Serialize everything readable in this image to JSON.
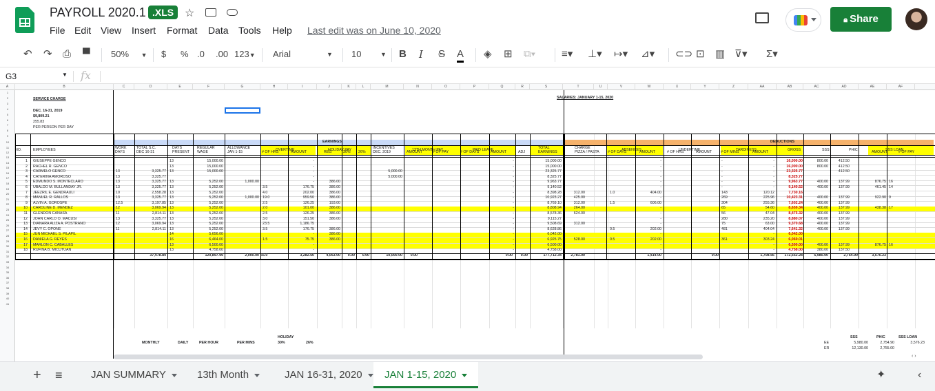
{
  "doc": {
    "title": "PAYROLL 2020.1",
    "badge": ".XLS",
    "last_edit": "Last edit was on June 10, 2020",
    "share": "Share"
  },
  "menu": [
    "File",
    "Edit",
    "View",
    "Insert",
    "Format",
    "Data",
    "Tools",
    "Help"
  ],
  "toolbar": {
    "zoom": "50%",
    "currency": "$",
    "percent": "%",
    "dec0": ".0",
    "dec00": ".00",
    "fmt": "123",
    "font": "Arial",
    "size": "10",
    "bold": "B",
    "italic": "I",
    "strike": "S",
    "textcolor": "A"
  },
  "formula": {
    "namebox": "G3",
    "fx": "fx"
  },
  "colors": {
    "earnings": "#c9daf8",
    "deductions": "#f6b26b",
    "yellow": "#ffff00",
    "green": "#188038",
    "red": "#cc0000"
  },
  "columns": [
    "A",
    "B",
    "C",
    "D",
    "E",
    "F",
    "G",
    "H",
    "I",
    "J",
    "K",
    "L",
    "M",
    "N",
    "O",
    "P",
    "Q",
    "R",
    "S",
    "T",
    "U",
    "V",
    "W",
    "X",
    "Y",
    "Z",
    "AA",
    "AB",
    "AC",
    "AD",
    "AE",
    "AF"
  ],
  "rownums": [
    "1",
    "2",
    "3",
    "4",
    "5",
    "6",
    "7",
    "8",
    "9",
    "10",
    "11",
    "12",
    "13",
    "14",
    "15",
    "16",
    "17",
    "18",
    "19",
    "20",
    "21",
    "22",
    "23",
    "24",
    "25",
    "26",
    "27",
    "28",
    "29",
    "30",
    "31",
    "32",
    "33",
    "34",
    "35",
    "36",
    "37",
    "38",
    "39",
    "40",
    "41"
  ],
  "sheet": {
    "service": {
      "label": "SERVICE CHARGE",
      "period": "DEC. 16-31, 2019",
      "amount": "$9,809.21",
      "rate": "255.83",
      "per": "PER PERSON PER DAY"
    },
    "salaries_title": "SALARIES: JANUARY 1-15, 2020",
    "earnings": "EARNINGS",
    "deductions": "DEDUCTIONS",
    "h1": {
      "no": "NO.",
      "emp": "EMPLOYEES",
      "work": "WORK",
      "total_sc": "TOTAL S.C.",
      "days": "DAYS",
      "regular": "REGULAR",
      "allow": "ALLOWANCE",
      "ot": "OVERTIME",
      "holiday": "HOLIDAY PAY",
      "incent": "INCENTIVES",
      "month13": "13TH MONTH PAY",
      "paid": "PAID LEAVE",
      "total": "TOTAL",
      "charge": "CHARGE",
      "absences": "ABSENCES",
      "undertime": "UNDERTIME",
      "tard": "TARDINESS",
      "gross": "GROSS",
      "sss": "SSS",
      "phic": "PHIC",
      "sssloan": "SSS LOAN"
    },
    "h2": {
      "work": "DAYS",
      "total_sc": "DEC 16-31",
      "days": "PRESENT",
      "regular": "WAGE",
      "allow": "JAN 1-15",
      "ot1": "# OF HRS",
      "ot2": "AMOUNT",
      "hol1": "REG",
      "hol2": "30%",
      "hol3": "26%",
      "incent": "DEC. 2019",
      "m1": "AMOUNT",
      "m2": "# OF PAY",
      "p1": "# OF DAYS",
      "p2": "AMOUNT",
      "adj": "ADJ",
      "total": "EARNINGS",
      "charge": "PIZZA / PASTA",
      "ab1": "# OF DAYS",
      "ab2": "AMOUNT",
      "u1": "# OF HRS",
      "u2": "AMOUNT",
      "t1": "# OF MINS",
      "t2": "AMOUNT",
      "sl1": "AMOUNT",
      "sl2": "# OF PAY"
    },
    "rows": [
      {
        "no": "1",
        "name": "GIUSEPPE GENCO",
        "c": "",
        "d": "",
        "e": "13",
        "f": "15,000.00",
        "g": "",
        "h": "",
        "i": "-",
        "j": "",
        "m": "",
        "p": "-",
        "s": "15,000.00",
        "u": "",
        "v": "",
        "w": "-",
        "y": "-",
        "aa": "-",
        "ab": "16,000.00",
        "ac": "800.00",
        "ad": "412.50",
        "ae": "",
        "af": "",
        "hl": false
      },
      {
        "no": "2",
        "name": "RACHEL R. GENCO",
        "c": "",
        "d": "",
        "e": "13",
        "f": "15,000.00",
        "g": "",
        "h": "",
        "i": "-",
        "j": "",
        "m": "",
        "p": "-",
        "s": "15,000.00",
        "u": "",
        "v": "",
        "w": "-",
        "y": "-",
        "aa": "-",
        "ab": "16,000.00",
        "ac": "800.00",
        "ad": "412.50",
        "ae": "",
        "af": "",
        "hl": false
      },
      {
        "no": "3",
        "name": "CARMELO GENCO",
        "c": "13",
        "d": "3,325.77",
        "e": "13",
        "f": "15,000.00",
        "g": "",
        "h": "",
        "i": "-",
        "j": "",
        "m": "5,000.00",
        "p": "-",
        "s": "23,325.77",
        "u": "",
        "v": "",
        "w": "-",
        "y": "-",
        "aa": "-",
        "ab": "23,325.77",
        "ac": "",
        "ad": "412.50",
        "ae": "",
        "af": "",
        "hl": false
      },
      {
        "no": "4",
        "name": "CATERINA AMOROSO",
        "c": "13",
        "d": "3,325.77",
        "e": "",
        "f": "",
        "g": "",
        "h": "",
        "i": "-",
        "j": "",
        "m": "5,000.00",
        "p": "-",
        "s": "8,325.77",
        "u": "",
        "v": "",
        "w": "-",
        "y": "-",
        "aa": "-",
        "ab": "8,325.77",
        "ac": "",
        "ad": "",
        "ae": "",
        "af": "",
        "hl": false
      },
      {
        "no": "5",
        "name": "EDMUNDO S. MONTECLARO",
        "c": "13",
        "d": "3,325.77",
        "e": "13",
        "f": "5,252.00",
        "g": "1,000.00",
        "h": "",
        "i": "-",
        "j": "386.00",
        "m": "",
        "p": "-",
        "s": "9,963.77",
        "u": "",
        "v": "",
        "w": "-",
        "y": "-",
        "aa": "-",
        "ab": "9,963.77",
        "ac": "400.00",
        "ad": "137.99",
        "ae": "876.75",
        "af": "16",
        "hl": false
      },
      {
        "no": "6",
        "name": "UBALDO M. BULLANDAY JR.",
        "c": "13",
        "d": "3,325.77",
        "e": "13",
        "f": "5,252.00",
        "g": "",
        "h": "3.5",
        "i": "176.75",
        "j": "386.00",
        "m": "",
        "p": "-",
        "s": "9,140.52",
        "u": "",
        "v": "",
        "w": "-",
        "y": "-",
        "aa": "-",
        "ab": "9,140.52",
        "ac": "400.00",
        "ad": "137.99",
        "ae": "461.45",
        "af": "14",
        "hl": false
      },
      {
        "no": "7",
        "name": "JEEZRIL E. GENDRAULI",
        "c": "10",
        "d": "2,558.28",
        "e": "13",
        "f": "5,252.00",
        "g": "",
        "h": "4.0",
        "i": "202.00",
        "j": "386.00",
        "m": "",
        "p": "-",
        "s": "8,398.28",
        "u": "312.00",
        "v": "1.0",
        "w": "404.00",
        "y": "143",
        "aa": "120.12",
        "ab": "7,730.16",
        "ac": "",
        "ad": "",
        "ae": "",
        "af": "",
        "hl": false
      },
      {
        "no": "8",
        "name": "MANUEL R. RALLOS",
        "c": "13",
        "d": "3,325.77",
        "e": "13",
        "f": "5,252.00",
        "g": "1,000.00",
        "h": "19.0",
        "i": "959.50",
        "j": "386.00",
        "m": "",
        "p": "-",
        "s": "10,923.27",
        "u": "425.00",
        "v": "",
        "w": "-",
        "y": "269",
        "aa": "225.96",
        "ab": "10,423.31",
        "ac": "400.00",
        "ad": "137.99",
        "ae": "922.90",
        "af": "9",
        "hl": false
      },
      {
        "no": "9",
        "name": "ALVIN A. GOROSPE",
        "c": "12.5",
        "d": "3,197.85",
        "e": "13",
        "f": "5,252.00",
        "g": "",
        "h": "2.5",
        "i": "126.25",
        "j": "193.00",
        "m": "",
        "p": "-",
        "s": "8,769.10",
        "u": "312.00",
        "v": "1.5",
        "w": "606.00",
        "y": "304",
        "aa": "255.36",
        "ab": "7,602.24",
        "ac": "400.00",
        "ad": "137.99",
        "ae": "",
        "af": "",
        "hl": false
      },
      {
        "no": "10",
        "name": "CAROLINE D. MENDEZ",
        "c": "12",
        "d": "3,069.94",
        "e": "13",
        "f": "5,252.00",
        "g": "",
        "h": "2.0",
        "i": "101.00",
        "j": "386.00",
        "m": "",
        "p": "-",
        "s": "8,808.94",
        "u": "264.00",
        "v": "",
        "w": "-",
        "y": "65",
        "aa": "54.60",
        "ab": "8,659.34",
        "ac": "400.00",
        "ad": "137.99",
        "ae": "438.38",
        "af": "17",
        "hl": true
      },
      {
        "no": "11",
        "name": "GLENDON CANASA",
        "c": "11",
        "d": "2,814.11",
        "e": "13",
        "f": "5,252.00",
        "g": "",
        "h": "2.5",
        "i": "126.25",
        "j": "386.00",
        "m": "",
        "p": "-",
        "s": "8,578.36",
        "u": "624.00",
        "v": "",
        "w": "-",
        "y": "56",
        "aa": "47.04",
        "ab": "8,475.32",
        "ac": "400.00",
        "ad": "137.99",
        "ae": "",
        "af": "",
        "hl": false
      },
      {
        "no": "12",
        "name": "JOHN CARLO O. MACUSI",
        "c": "13",
        "d": "3,325.77",
        "e": "13",
        "f": "5,252.00",
        "g": "",
        "h": "3.0",
        "i": "151.50",
        "j": "386.00",
        "m": "",
        "p": "-",
        "s": "9,115.27",
        "u": "",
        "v": "",
        "w": "-",
        "y": "280",
        "aa": "235.20",
        "ab": "8,880.07",
        "ac": "400.00",
        "ad": "137.99",
        "ae": "",
        "af": "",
        "hl": false
      },
      {
        "no": "13",
        "name": "DIANARA ALIZA A. POSTRANO",
        "c": "12",
        "d": "3,069.94",
        "e": "13",
        "f": "5,252.00",
        "g": "",
        "h": "23.5",
        "i": "1,186.75",
        "j": "",
        "m": "",
        "p": "-",
        "s": "9,508.69",
        "u": "312.00",
        "v": "",
        "w": "-",
        "y": "75",
        "aa": "63.00",
        "ab": "9,370.68",
        "ac": "400.00",
        "ad": "137.99",
        "ae": "",
        "af": "",
        "hl": false
      },
      {
        "no": "14",
        "name": "JEVY C. OPONE",
        "c": "11",
        "d": "2,814.11",
        "e": "13",
        "f": "5,252.00",
        "g": "",
        "h": "3.5",
        "i": "176.75",
        "j": "386.00",
        "m": "",
        "p": "-",
        "s": "8,628.86",
        "u": "",
        "v": "0.5",
        "w": "202.00",
        "y": "481",
        "aa": "404.04",
        "ab": "7,641.32",
        "ac": "400.00",
        "ad": "137.99",
        "ae": "",
        "af": "",
        "hl": false
      },
      {
        "no": "15",
        "name": "JUN MICHAEL S. PILAPIL",
        "c": "",
        "d": "",
        "e": "14",
        "f": "5,656.00",
        "g": "",
        "h": "",
        "i": "-",
        "j": "386.00",
        "m": "",
        "p": "-",
        "s": "6,042.00",
        "u": "",
        "v": "",
        "w": "-",
        "y": "",
        "aa": "-",
        "ab": "6,042.00",
        "ac": "",
        "ad": "",
        "ae": "",
        "af": "",
        "hl": true
      },
      {
        "no": "16",
        "name": "DANIELA G. REYES",
        "c": "",
        "d": "",
        "e": "16",
        "f": "6,464.00",
        "g": "",
        "h": "1.5",
        "i": "75.75",
        "j": "386.00",
        "m": "",
        "p": "-",
        "s": "6,925.75",
        "u": "528.00",
        "v": "0.5",
        "w": "202.00",
        "y": "361",
        "aa": "303.24",
        "ab": "6,069.01",
        "ac": "",
        "ad": "",
        "ae": "",
        "af": "",
        "hl": true
      },
      {
        "no": "17",
        "name": "MARLON C. CABALLES",
        "c": "",
        "d": "",
        "e": "13",
        "f": "6,500.00",
        "g": "",
        "h": "",
        "i": "-",
        "j": "",
        "m": "",
        "p": "-",
        "s": "6,500.00",
        "u": "",
        "v": "",
        "w": "-",
        "y": "",
        "aa": "-",
        "ab": "6,500.00",
        "ac": "400.00",
        "ad": "137.99",
        "ae": "876.75",
        "af": "16",
        "hl": true
      },
      {
        "no": "18",
        "name": "RUFINA B. MICUTUAN",
        "c": "",
        "d": "",
        "e": "13",
        "f": "4,758.00",
        "g": "",
        "h": "",
        "i": "-",
        "j": "",
        "m": "",
        "p": "-",
        "s": "4,758.00",
        "u": "",
        "v": "",
        "w": "-",
        "y": "",
        "aa": "-",
        "ab": "4,758.00",
        "ac": "380.00",
        "ad": "137.50",
        "ae": "",
        "af": "",
        "hl": false
      }
    ],
    "totals": {
      "d": "37,478.84",
      "f": "120,897.99",
      "g": "2,000.00",
      "h": "65.0",
      "i": "3,282.50",
      "j": "4,053.00",
      "k": "0.00",
      "l": "0.00",
      "m": "10,000.00",
      "n": "0.00",
      "q": "0.00",
      "r": "0.00",
      "s": "177,712.34",
      "u": "2,781.00",
      "w": "1,414.00",
      "y": "0.00",
      "aa": "1,708.56",
      "ab": "172,552.28",
      "ac": "5,980.00",
      "ad": "2,754.90",
      "ae": "3,576.23"
    },
    "footer": {
      "holiday": "HOLIDAY",
      "monthly": "MONTHLY",
      "daily": "DAILY",
      "perhour": "PER HOUR",
      "permins": "PER MINS",
      "p30": "30%",
      "p26": "26%",
      "sss": "SSS",
      "phic": "PHIC",
      "sssloan": "SSS LOAN",
      "ee": "EE",
      "er": "ER",
      "ee_sss": "5,980.00",
      "ee_phic": "2,754.90",
      "ee_loan": "3,576.23",
      "er_sss": "12,130.00",
      "er_phic": "2,755.00"
    }
  },
  "tabs": [
    "JAN SUMMARY",
    "13th Month",
    "JAN 16-31, 2020",
    "JAN 1-15, 2020"
  ],
  "icons": [
    "sheets-logo",
    "star-icon",
    "move-icon",
    "cloud-icon",
    "comment-icon",
    "meet-icon",
    "lock-icon",
    "undo-icon",
    "redo-icon",
    "print-icon",
    "paint-format-icon",
    "bold-icon",
    "italic-icon",
    "strikethrough-icon",
    "text-color-icon",
    "fill-color-icon",
    "borders-icon",
    "merge-icon",
    "align-icon",
    "valign-icon",
    "wrap-icon",
    "rotate-icon",
    "link-icon",
    "comment-add-icon",
    "chart-icon",
    "filter-icon",
    "functions-icon",
    "add-sheet-icon",
    "all-sheets-icon",
    "explore-icon",
    "collapse-icon"
  ]
}
